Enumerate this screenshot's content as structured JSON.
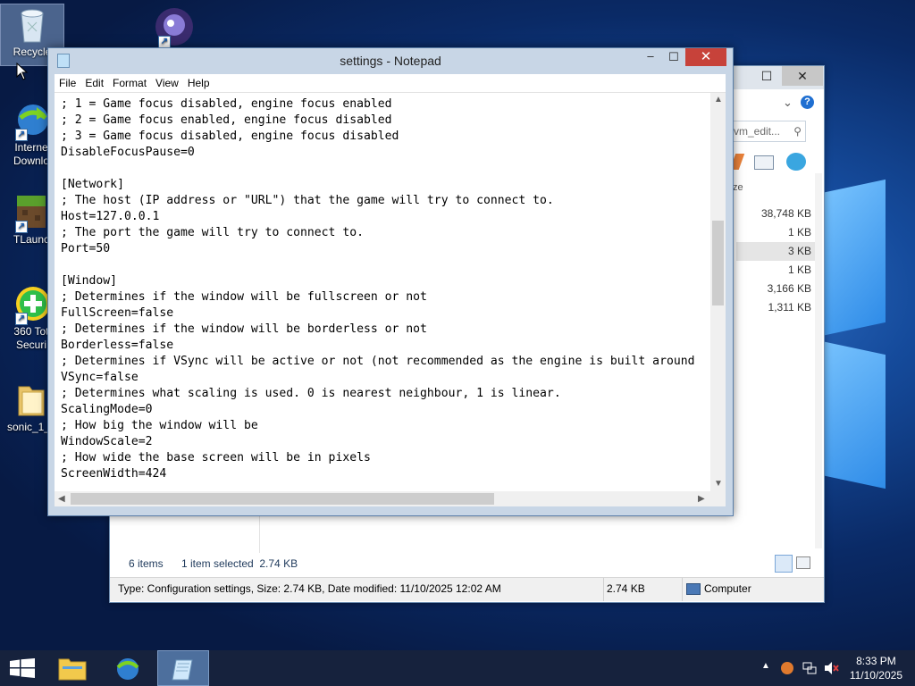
{
  "desktop": {
    "icons": [
      {
        "label": "Recycle"
      },
      {
        "label": ""
      },
      {
        "label": "Interne\nDownlo"
      },
      {
        "label": "TLaunc"
      },
      {
        "label": "360 Tot\nSecuri"
      },
      {
        "label": "sonic_1_c"
      }
    ]
  },
  "explorer": {
    "search_placeholder": "vm_edit...",
    "size_column_label": "ze",
    "sizes": [
      "38,748 KB",
      "1 KB",
      "3 KB",
      "1 KB",
      "3,166 KB",
      "1,311 KB"
    ],
    "items_count": "6 items",
    "selected_info": "1 item selected  2.74 KB",
    "details": "Type: Configuration settings, Size: 2.74 KB, Date modified: 11/10/2025 12:02 AM",
    "detail_size": "2.74 KB",
    "location": "Computer"
  },
  "notepad": {
    "title": "settings - Notepad",
    "menu": [
      "File",
      "Edit",
      "Format",
      "View",
      "Help"
    ],
    "content": "; 1 = Game focus disabled, engine focus enabled\n; 2 = Game focus enabled, engine focus disabled\n; 3 = Game focus disabled, engine focus disabled\nDisableFocusPause=0\n\n[Network]\n; The host (IP address or \"URL\") that the game will try to connect to.\nHost=127.0.0.1\n; The port the game will try to connect to.\nPort=50\n\n[Window]\n; Determines if the window will be fullscreen or not\nFullScreen=false\n; Determines if the window will be borderless or not\nBorderless=false\n; Determines if VSync will be active or not (not recommended as the engine is built around\nVSync=false\n; Determines what scaling is used. 0 is nearest neighbour, 1 is linear.\nScalingMode=0\n; How big the window will be\nWindowScale=2\n; How wide the base screen will be in pixels\nScreenWidth=424"
  },
  "taskbar": {
    "time": "8:33 PM",
    "date": "11/10/2025"
  }
}
